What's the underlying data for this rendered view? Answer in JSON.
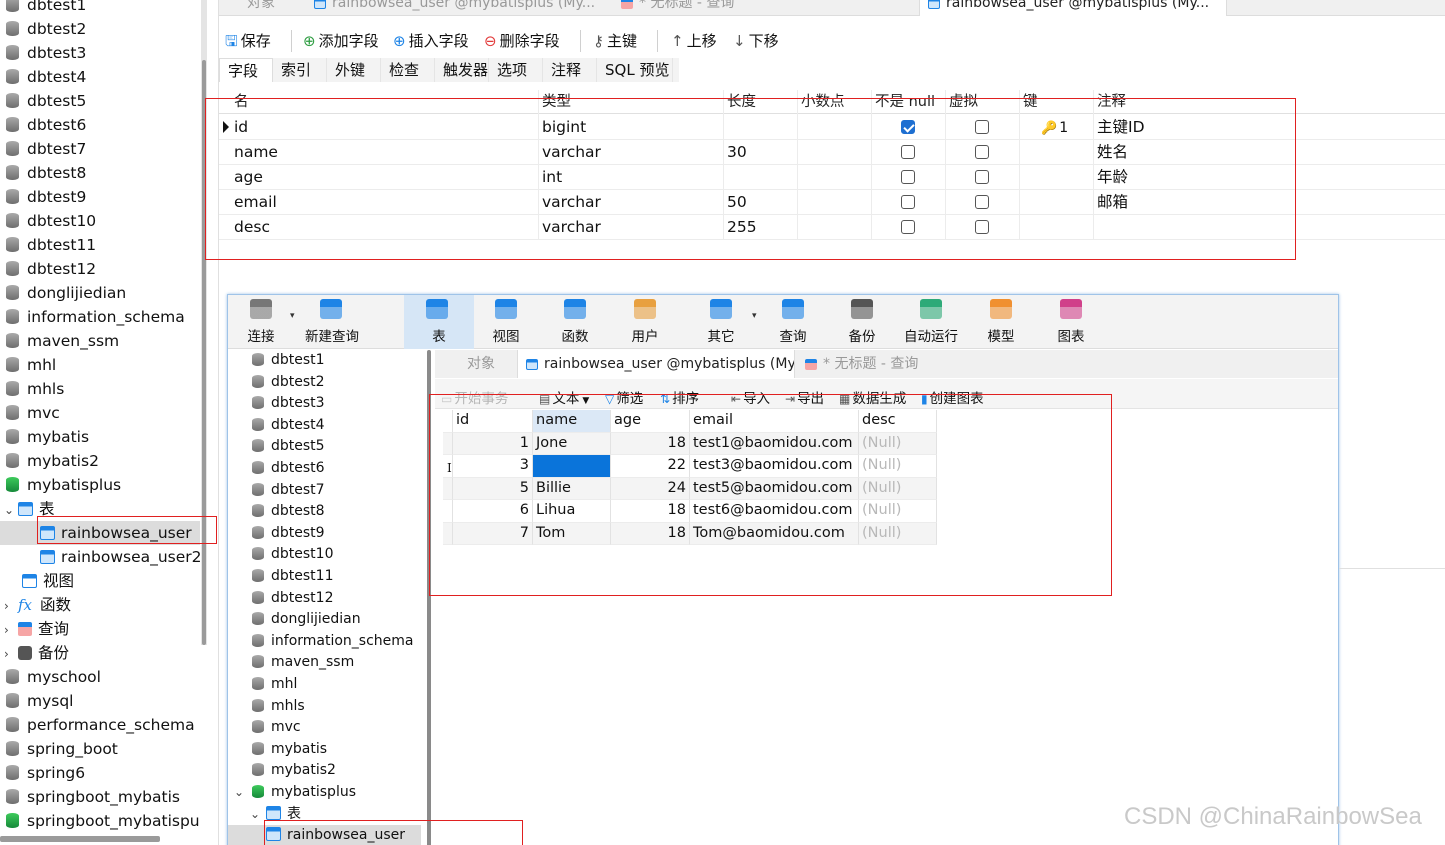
{
  "bg_tree": {
    "items": [
      {
        "label": "dbtest1",
        "type": "db"
      },
      {
        "label": "dbtest2",
        "type": "db"
      },
      {
        "label": "dbtest3",
        "type": "db"
      },
      {
        "label": "dbtest4",
        "type": "db"
      },
      {
        "label": "dbtest5",
        "type": "db"
      },
      {
        "label": "dbtest6",
        "type": "db"
      },
      {
        "label": "dbtest7",
        "type": "db"
      },
      {
        "label": "dbtest8",
        "type": "db"
      },
      {
        "label": "dbtest9",
        "type": "db"
      },
      {
        "label": "dbtest10",
        "type": "db"
      },
      {
        "label": "dbtest11",
        "type": "db"
      },
      {
        "label": "dbtest12",
        "type": "db"
      },
      {
        "label": "donglijiedian",
        "type": "db"
      },
      {
        "label": "information_schema",
        "type": "db"
      },
      {
        "label": "maven_ssm",
        "type": "db"
      },
      {
        "label": "mhl",
        "type": "db"
      },
      {
        "label": "mhls",
        "type": "db"
      },
      {
        "label": "mvc",
        "type": "db"
      },
      {
        "label": "mybatis",
        "type": "db"
      },
      {
        "label": "mybatis2",
        "type": "db"
      },
      {
        "label": "mybatisplus",
        "type": "db-open"
      },
      {
        "label": "表",
        "type": "tables-folder"
      },
      {
        "label": "rainbowsea_user",
        "type": "table-selected"
      },
      {
        "label": "rainbowsea_user2",
        "type": "table"
      },
      {
        "label": "视图",
        "type": "views"
      },
      {
        "label": "函数",
        "type": "functions"
      },
      {
        "label": "查询",
        "type": "queries"
      },
      {
        "label": "备份",
        "type": "backups"
      },
      {
        "label": "myschool",
        "type": "db"
      },
      {
        "label": "mysql",
        "type": "db"
      },
      {
        "label": "performance_schema",
        "type": "db"
      },
      {
        "label": "spring_boot",
        "type": "db"
      },
      {
        "label": "spring6",
        "type": "db"
      },
      {
        "label": "springboot_mybatis",
        "type": "db"
      },
      {
        "label": "springboot_mybatispu",
        "type": "db-open"
      }
    ]
  },
  "design": {
    "tabs": [
      "对象",
      "rainbowsea_user @mybatisplus (My...",
      "* 无标题 - 查询",
      "rainbowsea_user @mybatisplus (My..."
    ],
    "toolbar": {
      "save": "保存",
      "add_field": "添加字段",
      "insert_field": "插入字段",
      "delete_field": "删除字段",
      "primary_key": "主键",
      "move_up": "上移",
      "move_down": "下移"
    },
    "subtabs": [
      "字段",
      "索引",
      "外键",
      "检查",
      "触发器",
      "选项",
      "注释",
      "SQL 预览"
    ],
    "columns": [
      "名",
      "类型",
      "长度",
      "小数点",
      "不是 null",
      "虚拟",
      "键",
      "注释"
    ],
    "rows": [
      {
        "name": "id",
        "type": "bigint",
        "length": "",
        "decimals": "",
        "not_null": true,
        "virtual": false,
        "key": "1",
        "comment": "主键ID"
      },
      {
        "name": "name",
        "type": "varchar",
        "length": "30",
        "decimals": "",
        "not_null": false,
        "virtual": false,
        "key": "",
        "comment": "姓名"
      },
      {
        "name": "age",
        "type": "int",
        "length": "",
        "decimals": "",
        "not_null": false,
        "virtual": false,
        "key": "",
        "comment": "年龄"
      },
      {
        "name": "email",
        "type": "varchar",
        "length": "50",
        "decimals": "",
        "not_null": false,
        "virtual": false,
        "key": "",
        "comment": "邮箱"
      },
      {
        "name": "desc",
        "type": "varchar",
        "length": "255",
        "decimals": "",
        "not_null": false,
        "virtual": false,
        "key": "",
        "comment": ""
      }
    ]
  },
  "fg": {
    "toolbar": [
      {
        "label": "连接",
        "icon": "connection-icon",
        "color": "#777777"
      },
      {
        "label": "新建查询",
        "icon": "new-query-icon",
        "color": "#1e84e6"
      },
      {
        "label": "表",
        "icon": "table-icon",
        "color": "#1e84e6"
      },
      {
        "label": "视图",
        "icon": "view-icon",
        "color": "#1e84e6"
      },
      {
        "label": "函数",
        "icon": "function-icon",
        "color": "#1e84e6"
      },
      {
        "label": "用户",
        "icon": "user-icon",
        "color": "#e8a040"
      },
      {
        "label": "其它",
        "icon": "tools-icon",
        "color": "#1e84e6"
      },
      {
        "label": "查询",
        "icon": "query-icon",
        "color": "#1e84e6"
      },
      {
        "label": "备份",
        "icon": "backup-icon",
        "color": "#555555"
      },
      {
        "label": "自动运行",
        "icon": "robot-icon",
        "color": "#2eaa78"
      },
      {
        "label": "模型",
        "icon": "model-icon",
        "color": "#f09030"
      },
      {
        "label": "图表",
        "icon": "chart-icon",
        "color": "#d0408a"
      }
    ],
    "tree": [
      {
        "label": "dbtest1",
        "type": "db"
      },
      {
        "label": "dbtest2",
        "type": "db"
      },
      {
        "label": "dbtest3",
        "type": "db"
      },
      {
        "label": "dbtest4",
        "type": "db"
      },
      {
        "label": "dbtest5",
        "type": "db"
      },
      {
        "label": "dbtest6",
        "type": "db"
      },
      {
        "label": "dbtest7",
        "type": "db"
      },
      {
        "label": "dbtest8",
        "type": "db"
      },
      {
        "label": "dbtest9",
        "type": "db"
      },
      {
        "label": "dbtest10",
        "type": "db"
      },
      {
        "label": "dbtest11",
        "type": "db"
      },
      {
        "label": "dbtest12",
        "type": "db"
      },
      {
        "label": "donglijiedian",
        "type": "db"
      },
      {
        "label": "information_schema",
        "type": "db"
      },
      {
        "label": "maven_ssm",
        "type": "db"
      },
      {
        "label": "mhl",
        "type": "db"
      },
      {
        "label": "mhls",
        "type": "db"
      },
      {
        "label": "mvc",
        "type": "db"
      },
      {
        "label": "mybatis",
        "type": "db"
      },
      {
        "label": "mybatis2",
        "type": "db"
      },
      {
        "label": "mybatisplus",
        "type": "db-open"
      },
      {
        "label": "表",
        "type": "tables-folder"
      },
      {
        "label": "rainbowsea_user",
        "type": "table-selected"
      }
    ],
    "tabs": [
      "对象",
      "rainbowsea_user @mybatisplus (My...",
      "* 无标题 - 查询"
    ],
    "subtoolbar": {
      "begin_tx": "开始事务",
      "text": "文本",
      "filter": "筛选",
      "sort": "排序",
      "import": "导入",
      "export": "导出",
      "data_gen": "数据生成",
      "create_chart": "创建图表"
    },
    "grid": {
      "columns": [
        "id",
        "name",
        "age",
        "email",
        "desc"
      ],
      "rows": [
        {
          "id": "1",
          "name": "Jone",
          "age": "18",
          "email": "test1@baomidou.com",
          "desc": "(Null)"
        },
        {
          "id": "3",
          "name": "",
          "age": "22",
          "email": "test3@baomidou.com",
          "desc": "(Null)"
        },
        {
          "id": "5",
          "name": "Billie",
          "age": "24",
          "email": "test5@baomidou.com",
          "desc": "(Null)"
        },
        {
          "id": "6",
          "name": "Lihua",
          "age": "18",
          "email": "test6@baomidou.com",
          "desc": "(Null)"
        },
        {
          "id": "7",
          "name": "Tom",
          "age": "18",
          "email": "Tom@baomidou.com",
          "desc": "(Null)"
        }
      ]
    }
  },
  "watermark": "CSDN @ChinaRainbowSea",
  "colors": {
    "accent": "#1e84e6",
    "annotation_red": "#e02020",
    "selection": "#0a74da"
  }
}
